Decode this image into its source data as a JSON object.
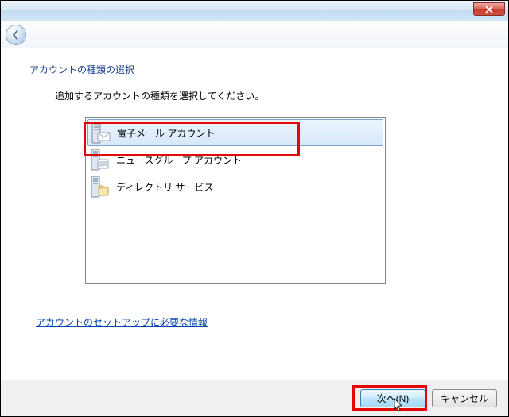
{
  "window": {
    "close_label": "Close"
  },
  "nav": {
    "back_label": "Back"
  },
  "page": {
    "heading": "アカウントの種類の選択",
    "instruction": "追加するアカウントの種類を選択してください。"
  },
  "accountTypes": [
    {
      "label": "電子メール アカウント",
      "icon": "server-mail"
    },
    {
      "label": "ニュースグループ アカウント",
      "icon": "server-news"
    },
    {
      "label": "ディレクトリ サービス",
      "icon": "server-directory"
    }
  ],
  "link": {
    "label": "アカウントのセットアップに必要な情報"
  },
  "buttons": {
    "next": "次へ(N)",
    "cancel": "キャンセル"
  }
}
